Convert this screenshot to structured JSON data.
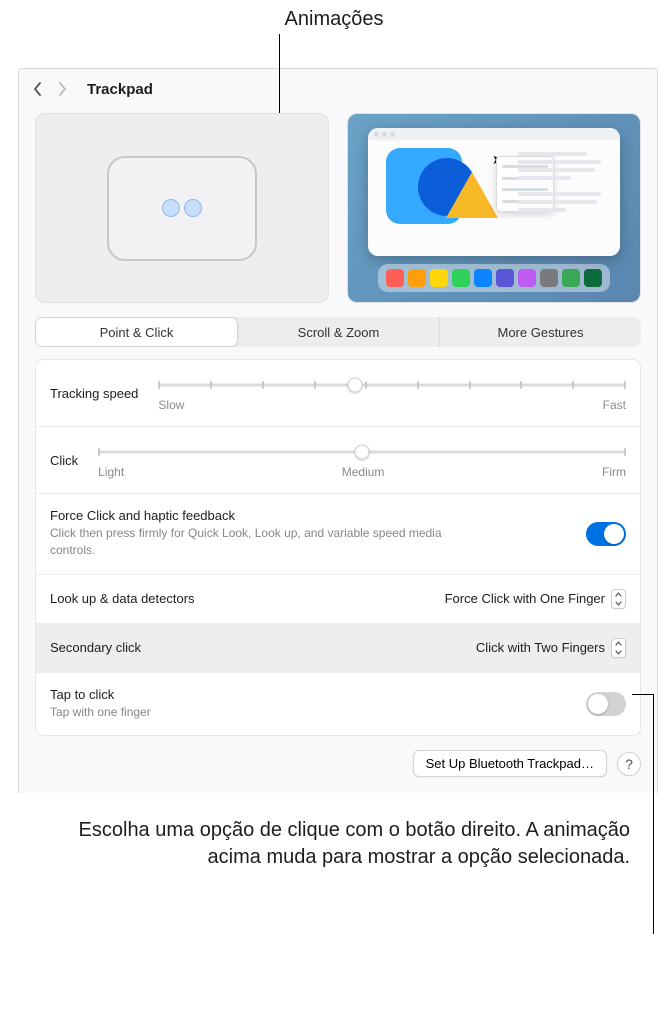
{
  "callouts": {
    "top": "Animações",
    "bottom": "Escolha uma opção de clique com o botão direito. A animação acima muda para mostrar a opção selecionada."
  },
  "window": {
    "title": "Trackpad"
  },
  "tabs": {
    "point_click": "Point & Click",
    "scroll_zoom": "Scroll & Zoom",
    "more_gestures": "More Gestures"
  },
  "tracking": {
    "label": "Tracking speed",
    "min": "Slow",
    "max": "Fast",
    "ticks": 10,
    "position_pct": 42
  },
  "click": {
    "label": "Click",
    "min": "Light",
    "mid": "Medium",
    "max": "Firm",
    "ticks": 3,
    "position_pct": 50
  },
  "force_click": {
    "label": "Force Click and haptic feedback",
    "desc": "Click then press firmly for Quick Look, Look up, and variable speed media controls.",
    "on": true
  },
  "lookup": {
    "label": "Look up & data detectors",
    "value": "Force Click with One Finger"
  },
  "secondary": {
    "label": "Secondary click",
    "value": "Click with Two Fingers"
  },
  "tap": {
    "label": "Tap to click",
    "desc": "Tap with one finger",
    "on": false
  },
  "footer": {
    "bluetooth": "Set Up Bluetooth Trackpad…",
    "help": "?"
  },
  "dock_colors": [
    "#ff5f57",
    "#ff9e0b",
    "#ffd60a",
    "#30d158",
    "#0a84ff",
    "#5856d6",
    "#bf5af2",
    "#7a7a7e",
    "#3aa757",
    "#0f6b3b"
  ]
}
